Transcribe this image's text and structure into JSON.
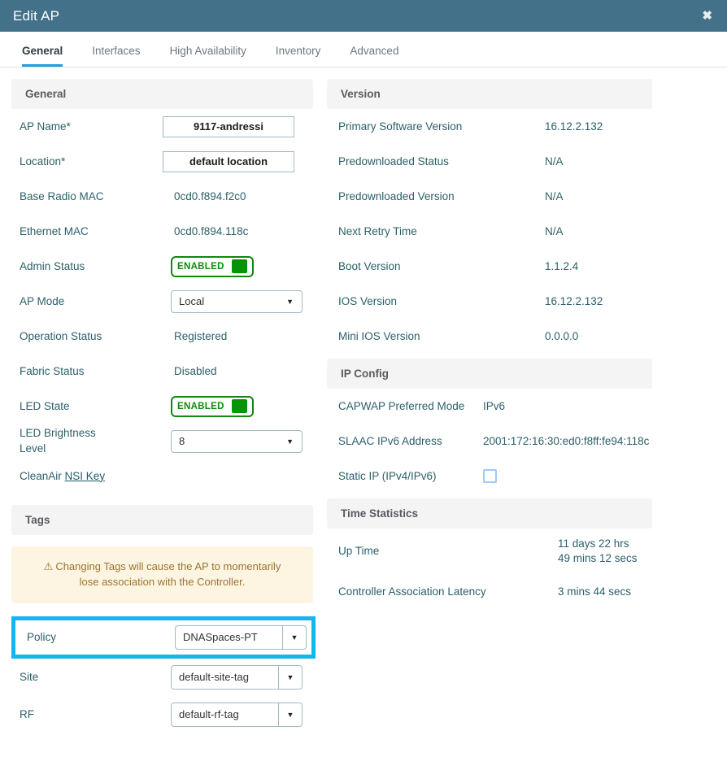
{
  "window": {
    "title": "Edit AP",
    "close_label": "✖"
  },
  "tabs": [
    {
      "label": "General",
      "active": true
    },
    {
      "label": "Interfaces",
      "active": false
    },
    {
      "label": "High Availability",
      "active": false
    },
    {
      "label": "Inventory",
      "active": false
    },
    {
      "label": "Advanced",
      "active": false
    }
  ],
  "sections": {
    "general": {
      "title": "General",
      "ap_name": {
        "label": "AP Name*",
        "value": "9117-andressi"
      },
      "location": {
        "label": "Location*",
        "value": "default location"
      },
      "base_radio_mac": {
        "label": "Base Radio MAC",
        "value": "0cd0.f894.f2c0"
      },
      "ethernet_mac": {
        "label": "Ethernet MAC",
        "value": "0cd0.f894.118c"
      },
      "admin_status": {
        "label": "Admin Status",
        "value": "ENABLED"
      },
      "ap_mode": {
        "label": "AP Mode",
        "value": "Local"
      },
      "operation_status": {
        "label": "Operation Status",
        "value": "Registered"
      },
      "fabric_status": {
        "label": "Fabric Status",
        "value": "Disabled"
      },
      "led_state": {
        "label": "LED State",
        "value": "ENABLED"
      },
      "led_brightness": {
        "label": "LED Brightness\nLevel",
        "value": "8"
      },
      "cleanair": {
        "label": "CleanAir",
        "link": "NSI Key"
      }
    },
    "tags": {
      "title": "Tags",
      "warning": "Changing Tags will cause the AP to momentarily lose association with the Controller.",
      "policy": {
        "label": "Policy",
        "value": "DNASpaces-PT"
      },
      "site": {
        "label": "Site",
        "value": "default-site-tag"
      },
      "rf": {
        "label": "RF",
        "value": "default-rf-tag"
      }
    },
    "version": {
      "title": "Version",
      "rows": [
        {
          "label": "Primary Software Version",
          "value": "16.12.2.132"
        },
        {
          "label": "Predownloaded Status",
          "value": "N/A"
        },
        {
          "label": "Predownloaded Version",
          "value": "N/A"
        },
        {
          "label": "Next Retry Time",
          "value": "N/A"
        },
        {
          "label": "Boot Version",
          "value": "1.1.2.4"
        },
        {
          "label": "IOS Version",
          "value": "16.12.2.132"
        },
        {
          "label": "Mini IOS Version",
          "value": "0.0.0.0"
        }
      ]
    },
    "ip_config": {
      "title": "IP Config",
      "capwap": {
        "label": "CAPWAP Preferred Mode",
        "value": "IPv6"
      },
      "slaac": {
        "label": "SLAAC IPv6 Address",
        "value": "2001:172:16:30:ed0:f8ff:fe94:118c"
      },
      "static_ip": {
        "label": "Static IP (IPv4/IPv6)",
        "checked": false
      }
    },
    "time_statistics": {
      "title": "Time Statistics",
      "up_time": {
        "label": "Up Time",
        "value": "11 days 22 hrs\n49 mins 12 secs"
      },
      "latency": {
        "label": "Controller Association Latency",
        "value": "3 mins 44 secs"
      }
    }
  },
  "icons": {
    "caret_down": "▼",
    "warning": "⚠"
  },
  "colors": {
    "titlebar": "#44718a",
    "accent_tab": "#1ba0e2",
    "highlight": "#14b6ef",
    "enabled_green": "#0c8a0c",
    "warning_bg": "#fdf5e1",
    "warning_text": "#9a7434",
    "label_text": "#2b6069"
  }
}
